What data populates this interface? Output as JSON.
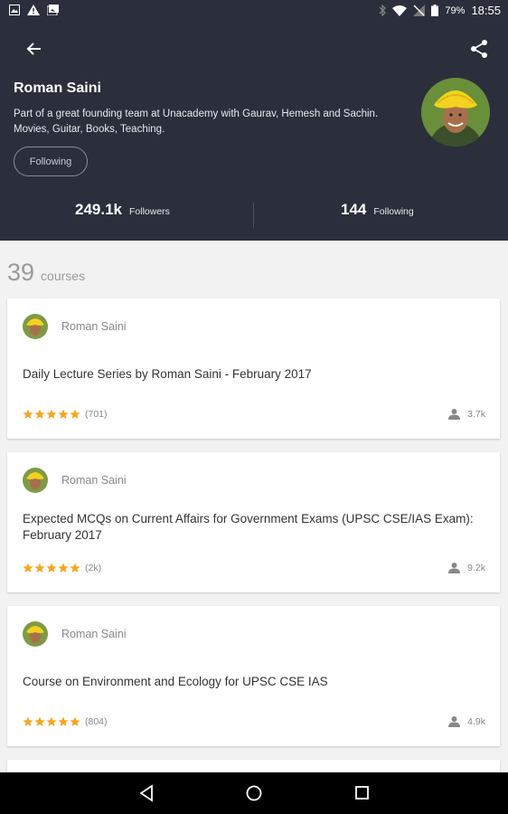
{
  "status_bar": {
    "battery": "79%",
    "time": "18:55"
  },
  "profile": {
    "name": "Roman Saini",
    "bio": "Part of a great founding team at Unacademy with Gaurav, Hemesh and Sachin. Movies, Guitar, Books, Teaching.",
    "follow_button": "Following",
    "followers_count": "249.1k",
    "followers_label": "Followers",
    "following_count": "144",
    "following_label": "Following"
  },
  "courses_header": {
    "count": "39",
    "label": "courses"
  },
  "courses": [
    {
      "author": "Roman Saini",
      "title": "Daily Lecture Series by Roman Saini - February 2017",
      "rating_count": "(701)",
      "learners": "3.7k"
    },
    {
      "author": "Roman Saini",
      "title": "Expected MCQs on Current Affairs for Government Exams (UPSC CSE/IAS Exam): February 2017",
      "rating_count": "(2k)",
      "learners": "9.2k"
    },
    {
      "author": "Roman Saini",
      "title": "Course on Environment and Ecology for UPSC CSE IAS",
      "rating_count": "(804)",
      "learners": "4.9k"
    }
  ],
  "colors": {
    "header_bg": "#2b2f3b",
    "star": "#f5a623",
    "page_bg": "#f2f2f2"
  },
  "icons": [
    "back-arrow-icon",
    "share-icon",
    "person-icon",
    "star-icon",
    "nav-back-icon",
    "nav-home-icon",
    "nav-recents-icon"
  ]
}
